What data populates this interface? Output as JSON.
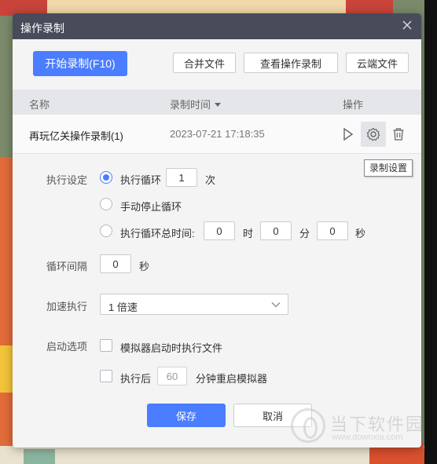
{
  "dialog": {
    "title": "操作录制"
  },
  "toolbar": {
    "start_record": "开始录制(F10)",
    "merge_files": "合并文件",
    "view_records": "查看操作录制",
    "cloud_files": "云端文件"
  },
  "table": {
    "headers": {
      "name": "名称",
      "time": "录制时间",
      "actions": "操作"
    },
    "rows": [
      {
        "name": "再玩亿关操作录制(1)",
        "time": "2023-07-21 17:18:35"
      }
    ]
  },
  "tooltip": "录制设置",
  "settings": {
    "exec_label": "执行设定",
    "loop_label": "执行循环",
    "loop_count": "1",
    "loop_unit": "次",
    "manual_stop": "手动停止循环",
    "total_time_label": "执行循环总时间:",
    "hours": "0",
    "hour_unit": "时",
    "minutes": "0",
    "minute_unit": "分",
    "seconds": "0",
    "second_unit": "秒",
    "interval_label": "循环间隔",
    "interval_value": "0",
    "interval_unit": "秒",
    "speed_label": "加速执行",
    "speed_value": "1 倍速",
    "startup_label": "启动选项",
    "startup_option": "模拟器启动时执行文件",
    "restart_prefix": "执行后",
    "restart_minutes": "60",
    "restart_suffix": "分钟重启模拟器",
    "selected_mode": "loop"
  },
  "footer": {
    "save": "保存",
    "cancel": "取消"
  },
  "watermark": {
    "name": "当下软件园",
    "url": "www.downxia.com"
  },
  "colors": {
    "accent": "#4a7dff",
    "titlebar": "#474b5a"
  }
}
